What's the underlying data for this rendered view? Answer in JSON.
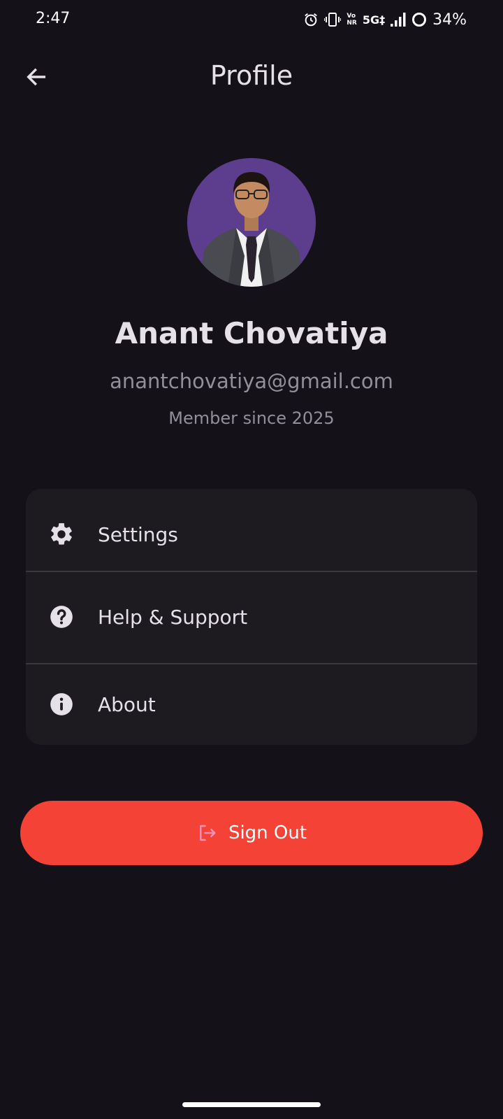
{
  "status_bar": {
    "time": "2:47",
    "vo": "Vo",
    "nr": "NR",
    "network": "5G‡",
    "battery": "34%"
  },
  "app_bar": {
    "title": "Profile"
  },
  "profile": {
    "name": "Anant Chovatiya",
    "email": "anantchovatiya@gmail.com",
    "member_since": "Member since 2025"
  },
  "menu": {
    "items": [
      {
        "label": "Settings",
        "icon": "gear-icon"
      },
      {
        "label": "Help & Support",
        "icon": "help-circle-icon"
      },
      {
        "label": "About",
        "icon": "info-icon"
      }
    ]
  },
  "actions": {
    "sign_out": "Sign Out"
  },
  "colors": {
    "background": "#141218",
    "card": "#1d1b20",
    "danger": "#f44336",
    "muted_text": "#938f99",
    "avatar_bg": "#5c3d8e"
  }
}
